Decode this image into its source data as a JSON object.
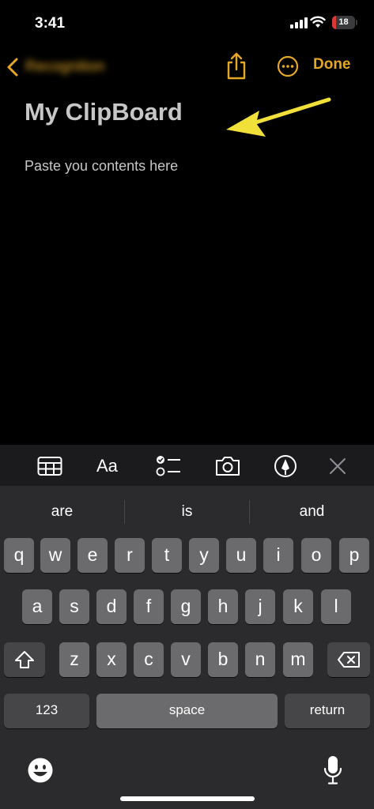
{
  "status_bar": {
    "time": "3:41",
    "battery_level": "18",
    "battery_fraction": 0.18
  },
  "nav": {
    "back_label": "Recognition",
    "done_label": "Done",
    "accent_color": "#e5a825"
  },
  "note": {
    "title": "My ClipBoard",
    "body": "Paste you contents here"
  },
  "annotation": {
    "arrow_color": "#f2e03a"
  },
  "toolbar": {
    "format_label": "Aa",
    "icons": [
      "table-icon",
      "format-icon",
      "checklist-icon",
      "camera-icon",
      "markup-icon",
      "close-icon"
    ]
  },
  "keyboard": {
    "suggestions": [
      "are",
      "is",
      "and"
    ],
    "row1": [
      "q",
      "w",
      "e",
      "r",
      "t",
      "y",
      "u",
      "i",
      "o",
      "p"
    ],
    "row2": [
      "a",
      "s",
      "d",
      "f",
      "g",
      "h",
      "j",
      "k",
      "l"
    ],
    "row3": [
      "z",
      "x",
      "c",
      "v",
      "b",
      "n",
      "m"
    ],
    "numbers_label": "123",
    "space_label": "space",
    "return_label": "return"
  }
}
